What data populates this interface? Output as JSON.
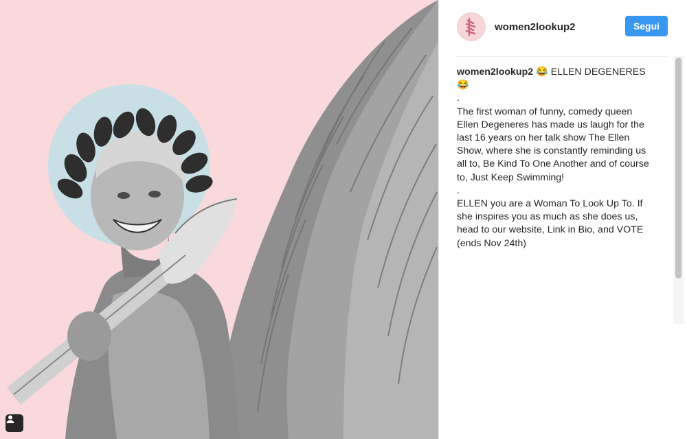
{
  "post": {
    "username": "women2lookup2",
    "follow_label": "Segui"
  },
  "caption": {
    "username": "women2lookup2",
    "title": "😂 ELLEN DEGENERES 😂",
    "dot1": ".",
    "paragraph1": "The first woman of funny, comedy queen Ellen Degeneres has made us laugh for the last 16 years on her talk show The Ellen Show, where she is constantly reminding us all to, Be Kind To One Another and of course to, Just Keep Swimming!",
    "dot2": ".",
    "paragraph2": "ELLEN you are a Woman To Look Up To. If she inspires you as much as she does us, head to our website, Link in Bio, and VOTE (ends Nov 24th)"
  },
  "icons": {
    "tag": "user-tag-icon",
    "avatar": "women2lookup2-logo"
  },
  "colors": {
    "background_pink": "#f9d9dc",
    "halo_blue": "#c8dfe6",
    "follow_blue": "#3897f0",
    "text": "#262626"
  }
}
